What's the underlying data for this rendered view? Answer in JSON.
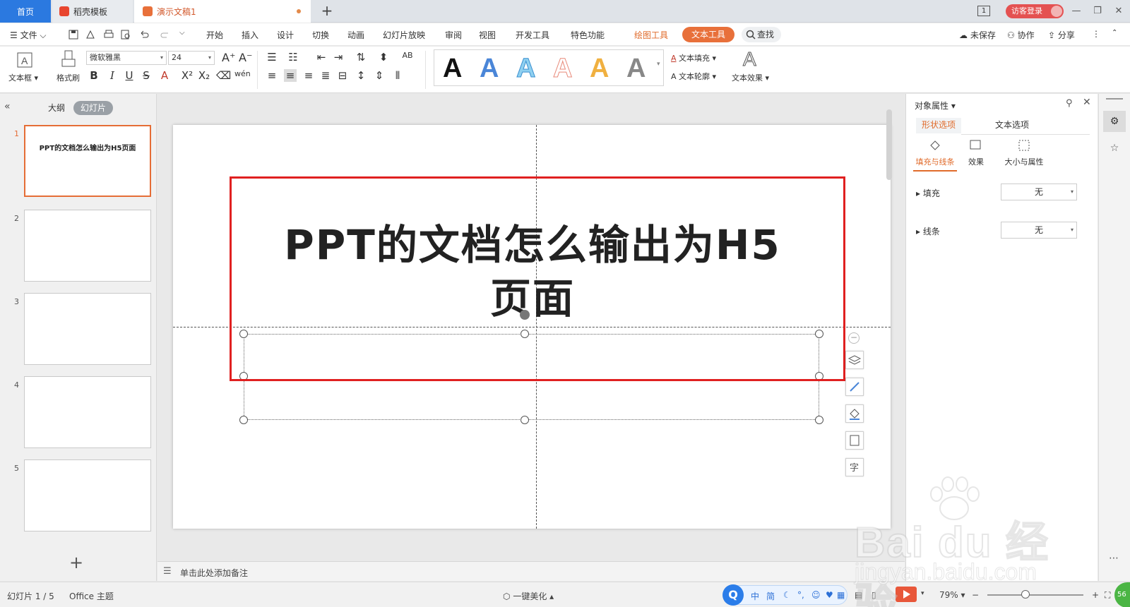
{
  "tabbar": {
    "home": "首页",
    "templates": "稻壳模板",
    "document": "演示文稿1",
    "badge_count": "1",
    "login": "访客登录"
  },
  "menubar": {
    "file": "文件",
    "items": [
      "开始",
      "插入",
      "设计",
      "切换",
      "动画",
      "幻灯片放映",
      "审阅",
      "视图",
      "开发工具",
      "特色功能"
    ],
    "draw_tools": "绘图工具",
    "text_tools": "文本工具",
    "search": "查找",
    "unsaved": "未保存",
    "collaborate": "协作",
    "share": "分享"
  },
  "ribbon": {
    "textbox": "文本框",
    "format_painter": "格式刷",
    "font_name": "微软雅黑",
    "font_size": "24",
    "text_fill": "文本填充",
    "text_outline": "文本轮廓",
    "text_effect": "文本效果",
    "style_letter": "A"
  },
  "leftpane": {
    "outline_tab": "大纲",
    "slides_tab": "幻灯片",
    "slides": [
      {
        "num": "1",
        "title": "PPT的文档怎么输出为H5页面"
      },
      {
        "num": "2",
        "title": ""
      },
      {
        "num": "3",
        "title": ""
      },
      {
        "num": "4",
        "title": ""
      },
      {
        "num": "5",
        "title": ""
      }
    ]
  },
  "slide": {
    "title_line1": "PPT的文档怎么输出为H5",
    "title_line2": "页面"
  },
  "notes": {
    "placeholder": "单击此处添加备注"
  },
  "rightpane": {
    "title": "对象属性",
    "tab_shape": "形状选项",
    "tab_text": "文本选项",
    "sub_fill_line": "填充与线条",
    "sub_effects": "效果",
    "sub_size": "大小与属性",
    "fill_label": "填充",
    "fill_value": "无",
    "line_label": "线条",
    "line_value": "无"
  },
  "statusbar": {
    "slide_counter": "幻灯片 1 / 5",
    "theme": "Office 主题",
    "beautify": "一键美化",
    "zoom": "79%",
    "ime_items": [
      "中",
      "简"
    ],
    "badge": "56"
  },
  "colors": {
    "accent_orange": "#e8703a",
    "brand_blue": "#2b79e0",
    "highlight_red": "#e02020"
  }
}
